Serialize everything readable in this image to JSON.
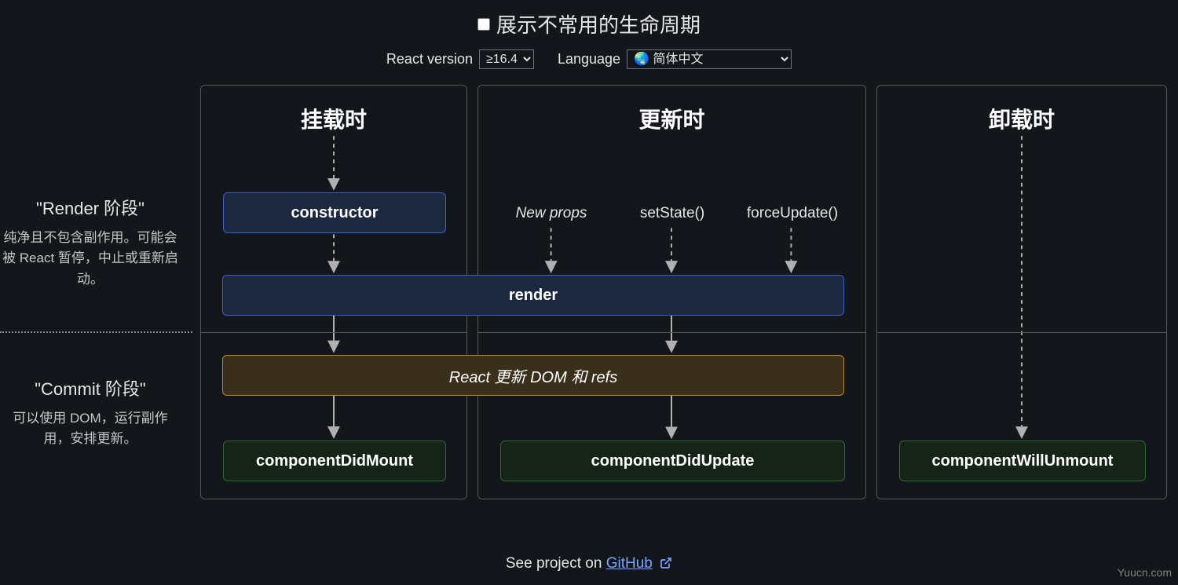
{
  "controls": {
    "checkbox_label": "展示不常用的生命周期",
    "version_label": "React version",
    "version_value": "≥16.4",
    "language_label": "Language",
    "language_value": "🌏 简体中文"
  },
  "phases": {
    "render": {
      "title": "\"Render 阶段\"",
      "desc": "纯净且不包含副作用。可能会被 React 暂停，中止或重新启动。"
    },
    "commit": {
      "title": "\"Commit 阶段\"",
      "desc": "可以使用 DOM，运行副作用，安排更新。"
    }
  },
  "columns": {
    "mounting": {
      "title": "挂载时"
    },
    "updating": {
      "title": "更新时"
    },
    "unmounting": {
      "title": "卸载时"
    }
  },
  "boxes": {
    "constructor": "constructor",
    "render": "render",
    "react_updates": "React 更新 DOM 和 refs",
    "did_mount": "componentDidMount",
    "did_update": "componentDidUpdate",
    "will_unmount": "componentWillUnmount"
  },
  "triggers": {
    "new_props": "New props",
    "set_state": "setState()",
    "force_update": "forceUpdate()"
  },
  "footer": {
    "prefix": "See project on ",
    "link_text": "GitHub"
  },
  "watermark": "Yuucn.com"
}
